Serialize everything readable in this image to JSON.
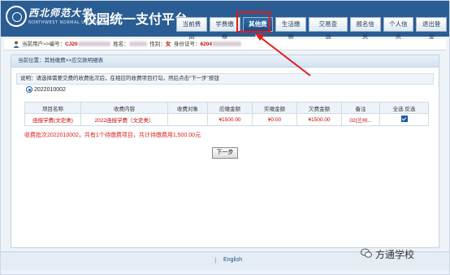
{
  "header": {
    "logo_text": "西北师范大学",
    "logo_sub": "NORTHWEST NORMAL UNIVERSITY",
    "platform_title": "校园统一支付平台",
    "nav": [
      {
        "label": "当前费用",
        "active": false
      },
      {
        "label": "学费缴费",
        "active": false
      },
      {
        "label": "其他费用",
        "active": true
      },
      {
        "label": "生活缴费",
        "active": false
      },
      {
        "label": "交易查询",
        "active": false
      },
      {
        "label": "报名信息",
        "active": false
      },
      {
        "label": "个人信息",
        "active": false
      },
      {
        "label": "退出登录",
        "active": false
      }
    ]
  },
  "userbar": {
    "current_user_label": "当前用户>>编号：",
    "user_id_prefix": "CJ20",
    "name_label": "姓名：",
    "gender_label": "性别：",
    "gender_value": "女",
    "id_label": "身份证号：",
    "id_prefix": "6204"
  },
  "panel": {
    "location": "当前位置：其他缴费>>应交款明细表",
    "note": "说明：请选择需要交费的收费批次后，在相应的收费项目打勾，然后点击“下一步”按钮",
    "batch_option": "2022010002",
    "table": {
      "headers": [
        "项目名称",
        "收费内容",
        "收费对象",
        "应缴金额",
        "实缴金额",
        "欠费金额",
        "备注",
        "全选 反选"
      ],
      "rows": [
        {
          "project": "函授学费(文史类)",
          "content": "2022函授学费（文史类）",
          "target": "",
          "due": "¥1500.00",
          "paid": "¥0.00",
          "owed": "¥1500.00",
          "remark": "02|兰州...",
          "selected": true
        }
      ]
    },
    "summary": "收费批次2022010002，共有1个待缴费项目，共计待缴费用1,500.00元",
    "next_button": "下一步"
  },
  "footer": {
    "separator": "|",
    "language_link": "English"
  },
  "watermark": "方通学校",
  "colors": {
    "header_bg": "#2a5d93",
    "highlight": "#e21b1b",
    "amount_text": "#cc0000"
  }
}
